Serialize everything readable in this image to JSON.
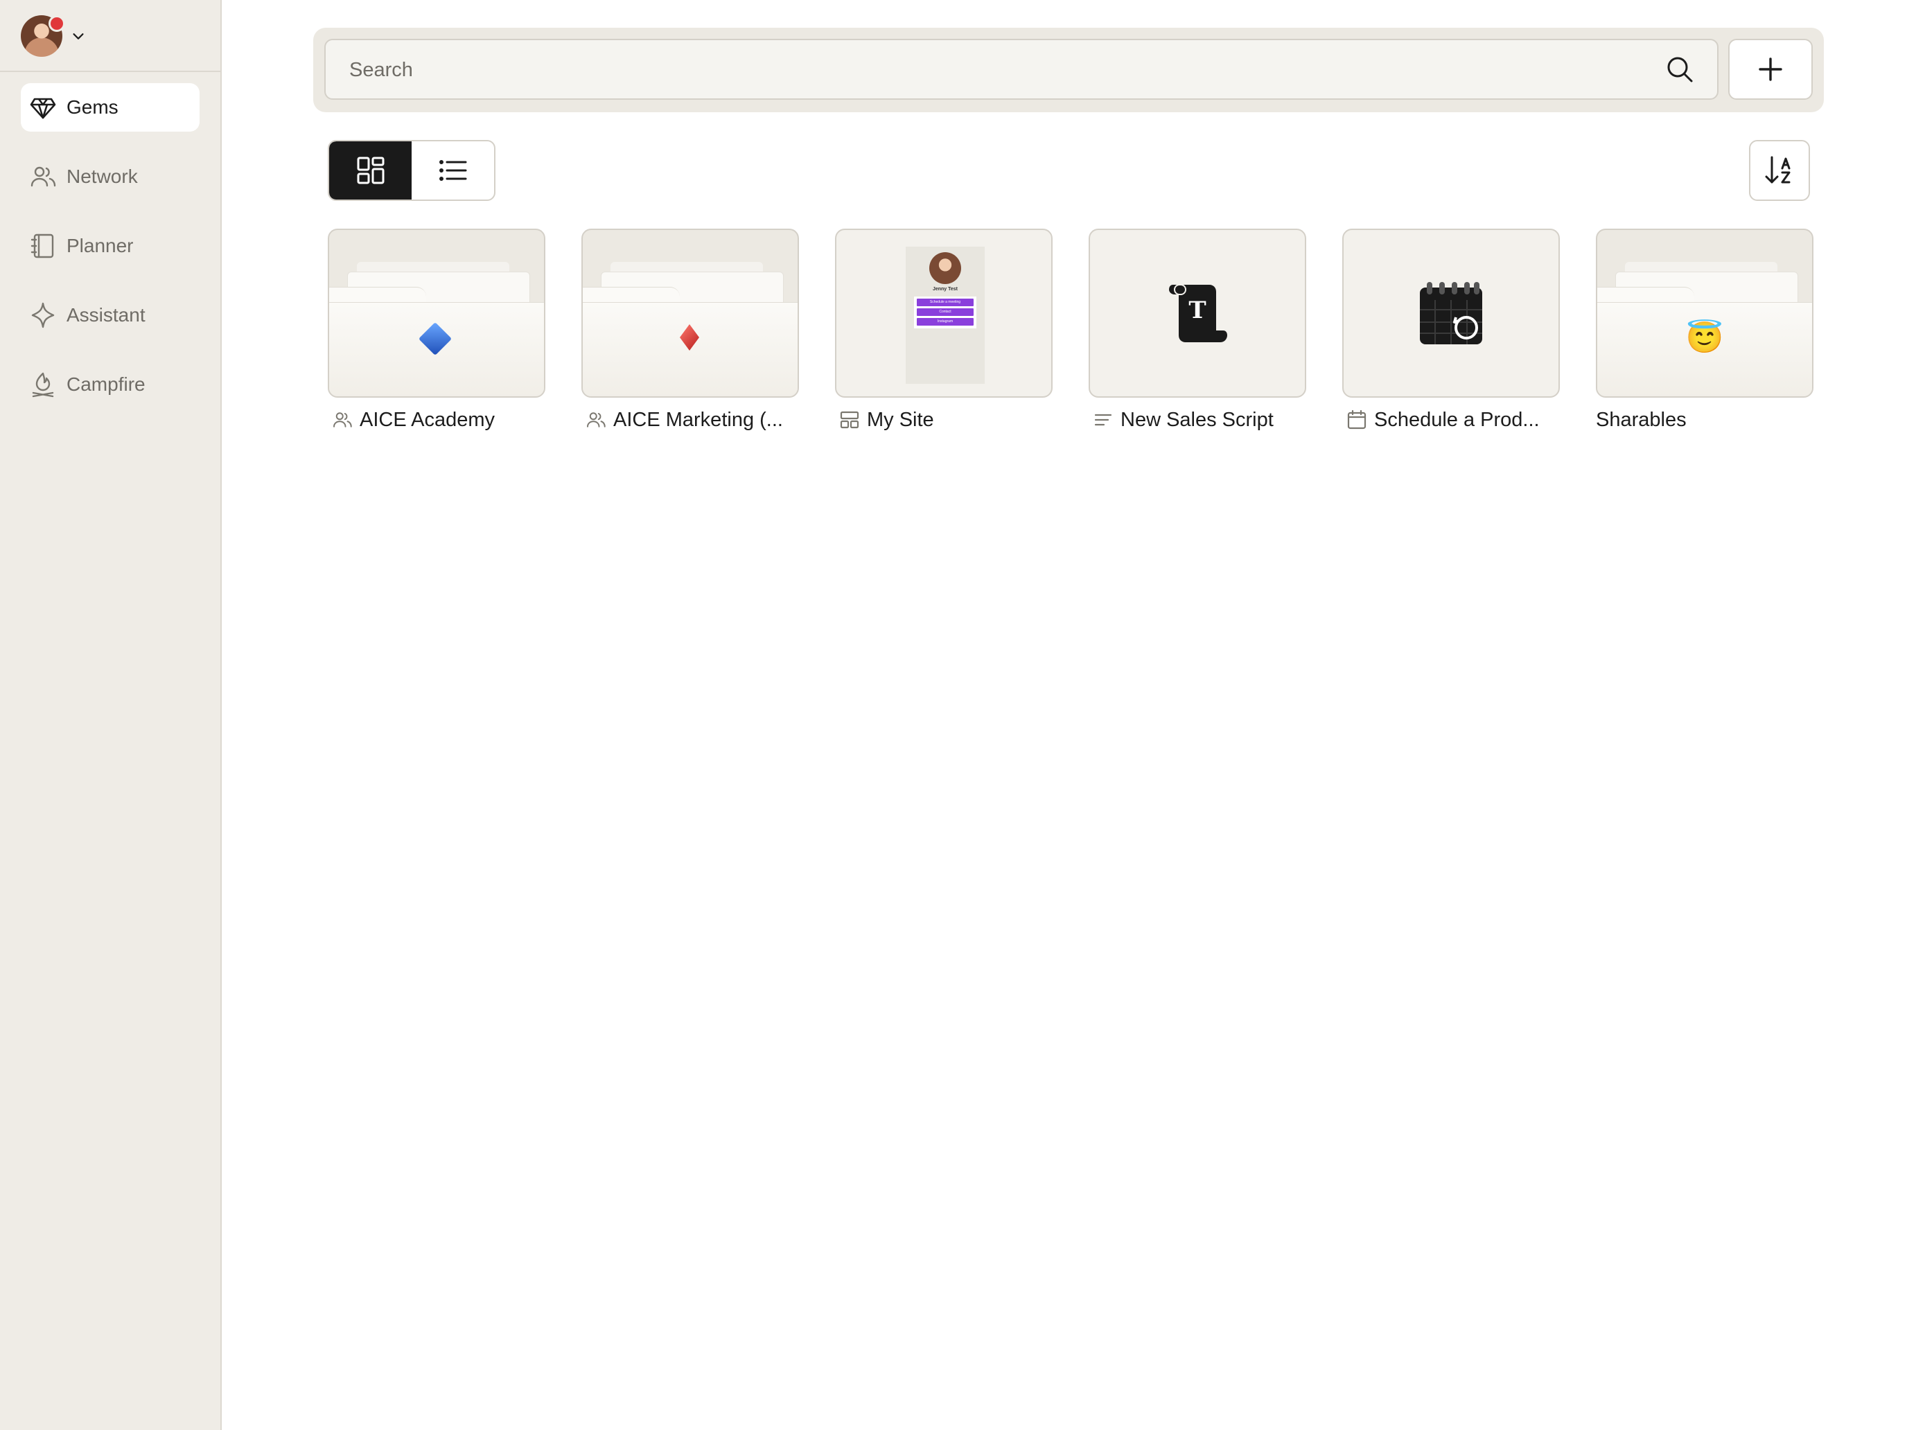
{
  "profile": {
    "avatar_alt": "User avatar"
  },
  "sidebar": {
    "items": [
      {
        "label": "Gems",
        "icon": "gem-icon",
        "active": true
      },
      {
        "label": "Network",
        "icon": "users-icon",
        "active": false
      },
      {
        "label": "Planner",
        "icon": "notebook-icon",
        "active": false
      },
      {
        "label": "Assistant",
        "icon": "sparkle-icon",
        "active": false
      },
      {
        "label": "Campfire",
        "icon": "campfire-icon",
        "active": false
      }
    ]
  },
  "search": {
    "placeholder": "Search",
    "value": ""
  },
  "view": {
    "selected": "grid"
  },
  "gems": [
    {
      "title": "AICE Academy",
      "type": "group-folder",
      "label_icon": "users-icon",
      "thumb": "blue-diamond"
    },
    {
      "title": "AICE Marketing (...",
      "type": "group-folder",
      "label_icon": "users-icon",
      "thumb": "red-diamond"
    },
    {
      "title": "My Site",
      "type": "site",
      "label_icon": "layout-icon",
      "thumb": "site-preview",
      "site_preview": {
        "name": "Jenny Test",
        "buttons": [
          "Schedule a meeting",
          "Contact",
          "Instagram"
        ]
      }
    },
    {
      "title": "New Sales Script",
      "type": "document",
      "label_icon": "text-lines-icon",
      "thumb": "script-scroll-icon"
    },
    {
      "title": "Schedule a Prod...",
      "type": "schedule",
      "label_icon": "calendar-icon",
      "thumb": "calendar-icon"
    },
    {
      "title": "Sharables",
      "type": "folder",
      "label_icon": "",
      "thumb": "😇"
    }
  ],
  "colors": {
    "sidebar_bg": "#efece6",
    "accent_dark": "#1a1a1a",
    "site_button": "#8a3fdc",
    "notification": "#e0383a"
  }
}
